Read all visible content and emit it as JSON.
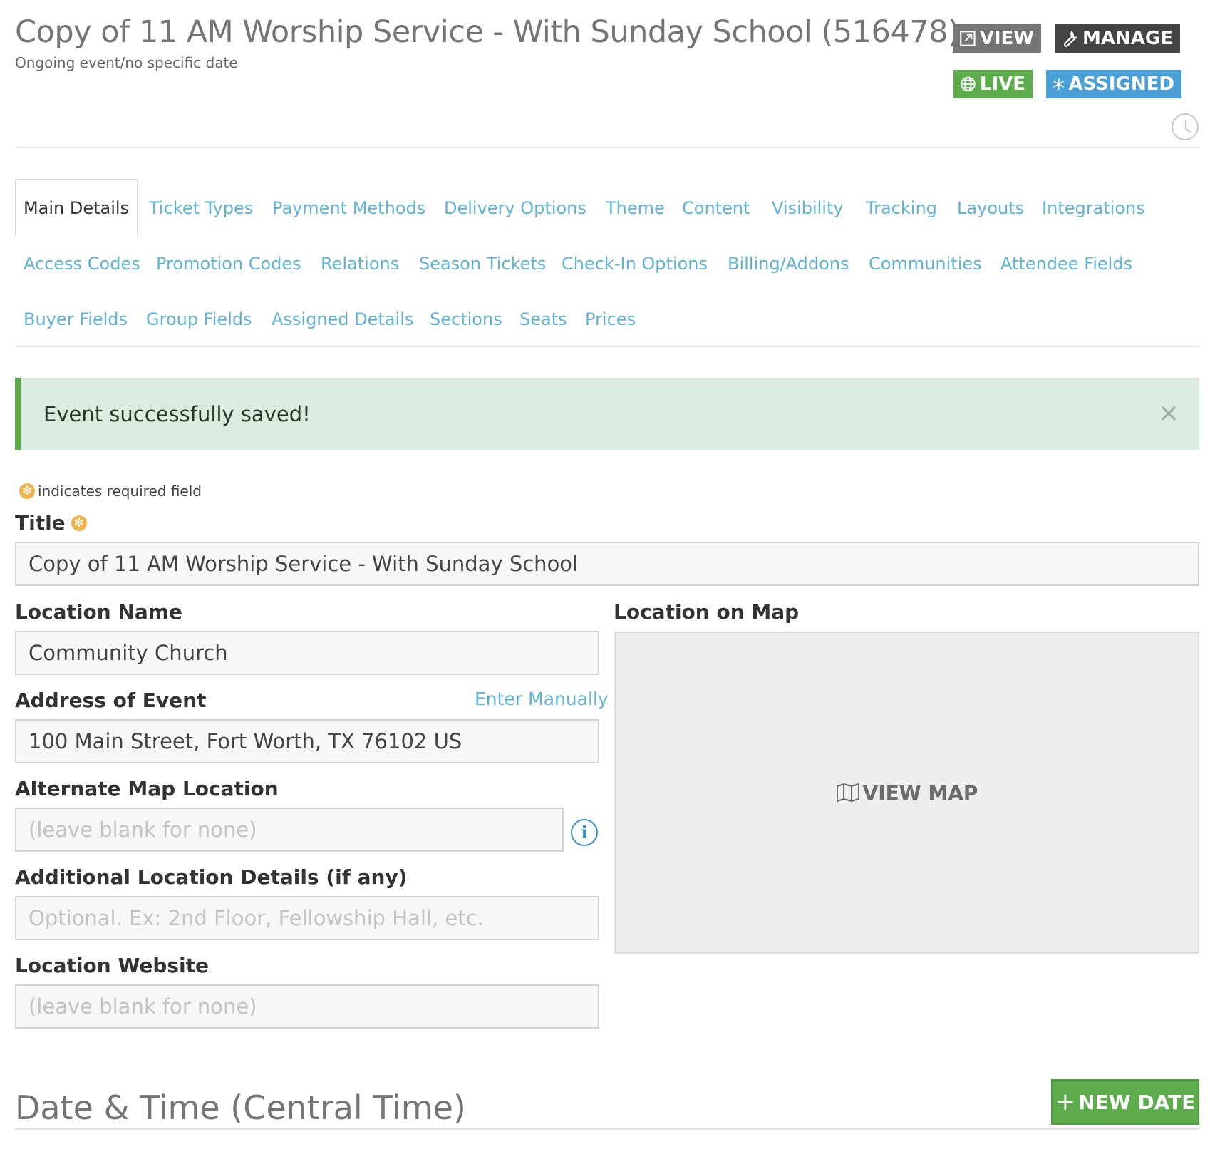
{
  "header": {
    "title": "Copy of 11 AM Worship Service - With Sunday School (516478)",
    "subtitle": "Ongoing event/no specific date",
    "view_label": "VIEW",
    "manage_label": "MANAGE",
    "live_label": "LIVE",
    "assigned_label": "ASSIGNED"
  },
  "tabs": [
    {
      "label": "Main Details",
      "active": true
    },
    {
      "label": "Ticket Types"
    },
    {
      "label": "Payment Methods"
    },
    {
      "label": "Delivery Options"
    },
    {
      "label": "Theme"
    },
    {
      "label": "Content"
    },
    {
      "label": "Visibility"
    },
    {
      "label": "Tracking"
    },
    {
      "label": "Layouts"
    },
    {
      "label": "Integrations"
    },
    {
      "label": "Access Codes"
    },
    {
      "label": "Promotion Codes"
    },
    {
      "label": "Relations"
    },
    {
      "label": "Season Tickets"
    },
    {
      "label": "Check-In Options"
    },
    {
      "label": "Billing/Addons"
    },
    {
      "label": "Communities"
    },
    {
      "label": "Attendee Fields"
    },
    {
      "label": "Buyer Fields"
    },
    {
      "label": "Group Fields"
    },
    {
      "label": "Assigned Details"
    },
    {
      "label": "Sections"
    },
    {
      "label": "Seats"
    },
    {
      "label": "Prices"
    }
  ],
  "alert": {
    "message": "Event successfully saved!",
    "close_glyph": "×"
  },
  "form": {
    "required_note": "indicates required field",
    "required_glyph": "✻",
    "title_label": "Title",
    "title_value": "Copy of 11 AM Worship Service - With Sunday School",
    "location_name_label": "Location Name",
    "location_name_value": "Community Church",
    "address_label": "Address of Event",
    "enter_manually": "Enter Manually",
    "address_value": "100 Main Street, Fort Worth, TX 76102 US",
    "alt_map_label": "Alternate Map Location",
    "alt_map_placeholder": "(leave blank for none)",
    "info_glyph": "i",
    "additional_label": "Additional Location Details (if any)",
    "additional_placeholder": "Optional. Ex: 2nd Floor, Fellowship Hall, etc.",
    "website_label": "Location Website",
    "website_placeholder": "(leave blank for none)",
    "map_label": "Location on Map",
    "view_map_label": "VIEW MAP"
  },
  "datetime": {
    "title": "Date & Time (Central Time)",
    "new_date_label": "NEW DATE",
    "plus_glyph": "+"
  },
  "colors": {
    "accent_link": "#5fb3d6",
    "live_green": "#5cac4c",
    "assigned_blue": "#4a9fd6",
    "manage_dark": "#444444",
    "view_gray": "#757575",
    "required_orange": "#f0b24a",
    "success_bg": "#dcebe0"
  }
}
